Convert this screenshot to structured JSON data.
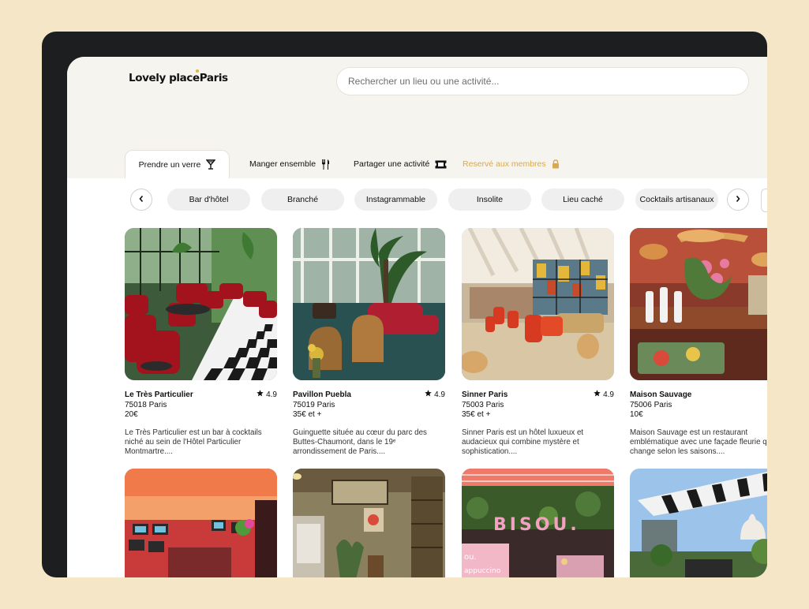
{
  "brand": {
    "name": "Lovely place",
    "city": "Paris"
  },
  "search": {
    "placeholder": "Rechercher un lieu ou une activité..."
  },
  "categories": [
    {
      "label": "Prendre un verre",
      "icon": "cocktail-icon"
    },
    {
      "label": "Manger ensemble",
      "icon": "cutlery-icon"
    },
    {
      "label": "Partager une activité",
      "icon": "ticket-icon"
    },
    {
      "label": "Reservé aux membres",
      "icon": "lock-icon"
    }
  ],
  "filters": [
    "Bar d'hôtel",
    "Branché",
    "Instagrammable",
    "Insolite",
    "Lieu caché",
    "Cocktails artisanaux"
  ],
  "places": [
    {
      "name": "Le Très Particulier",
      "rating": "4.9",
      "location": "75018 Paris",
      "price": "20€",
      "description": "Le Très Particulier est un bar à cocktails niché au sein de l'Hôtel Particulier Montmartre...."
    },
    {
      "name": "Pavillon Puebla",
      "rating": "4.9",
      "location": "75019 Paris",
      "price": "35€ et +",
      "description": "Guinguette située au cœur du parc des Buttes-Chaumont, dans le 19ᵉ arrondissement de Paris...."
    },
    {
      "name": "Sinner Paris",
      "rating": "4.9",
      "location": "75003 Paris",
      "price": "35€ et +",
      "description": "Sinner Paris est un hôtel luxueux et audacieux qui combine mystère et sophistication...."
    },
    {
      "name": "Maison Sauvage",
      "rating": "",
      "location": "75006 Paris",
      "price": "10€",
      "description": "Maison Sauvage est un restaurant emblématique avec une façade fleurie qui change selon les saisons...."
    }
  ],
  "row2_photos": [
    "photo-colorful-bar",
    "photo-cafe-interior",
    "photo-bisou-facade",
    "photo-rooftop-terrace"
  ],
  "row2_sign_text": "BISOU.",
  "row2_sign_text2": "ou.",
  "row2_sign_text3": "appuccino",
  "colors": {
    "page_bg": "#f5e6c8",
    "device": "#1c1e1f",
    "header_bg": "#f6f4ee",
    "accent_gold": "#d9a950",
    "chip_bg": "#efefef"
  }
}
